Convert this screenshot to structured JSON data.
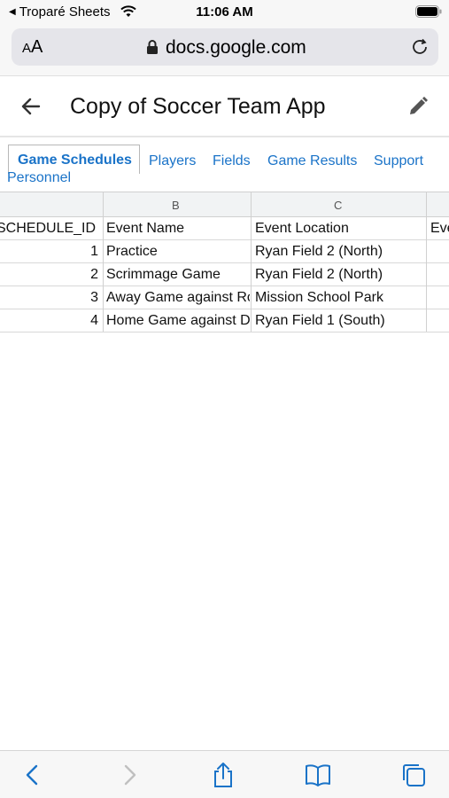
{
  "status_bar": {
    "back_app": "Troparé Sheets",
    "time": "11:06 AM"
  },
  "browser": {
    "text_size_label_small": "A",
    "text_size_label_large": "A",
    "url": "docs.google.com"
  },
  "app": {
    "title": "Copy of Soccer Team App"
  },
  "tabs": [
    {
      "label": "Game Schedules"
    },
    {
      "label": "Players"
    },
    {
      "label": "Fields"
    },
    {
      "label": "Game Results"
    },
    {
      "label": "Support"
    },
    {
      "label": "Personnel"
    }
  ],
  "sheet": {
    "column_letters": [
      "B",
      "C"
    ],
    "headers": [
      "SCHEDULE_ID",
      "Event Name",
      "Event Location",
      "Eve"
    ],
    "rows": [
      {
        "id": "1",
        "name": "Practice",
        "location": "Ryan Field 2 (North)"
      },
      {
        "id": "2",
        "name": "Scrimmage Game",
        "location": "Ryan Field 2 (North)"
      },
      {
        "id": "3",
        "name": "Away Game against Ro",
        "location": "Mission School Park"
      },
      {
        "id": "4",
        "name": "Home Game against De",
        "location": "Ryan Field 1 (South)"
      }
    ]
  },
  "colors": {
    "accent": "#1a73c8",
    "toolbar_icon": "#1a73c8"
  },
  "toolbar": {
    "icons": [
      "back-icon",
      "forward-icon",
      "share-icon",
      "bookmarks-icon",
      "tabs-icon"
    ]
  }
}
